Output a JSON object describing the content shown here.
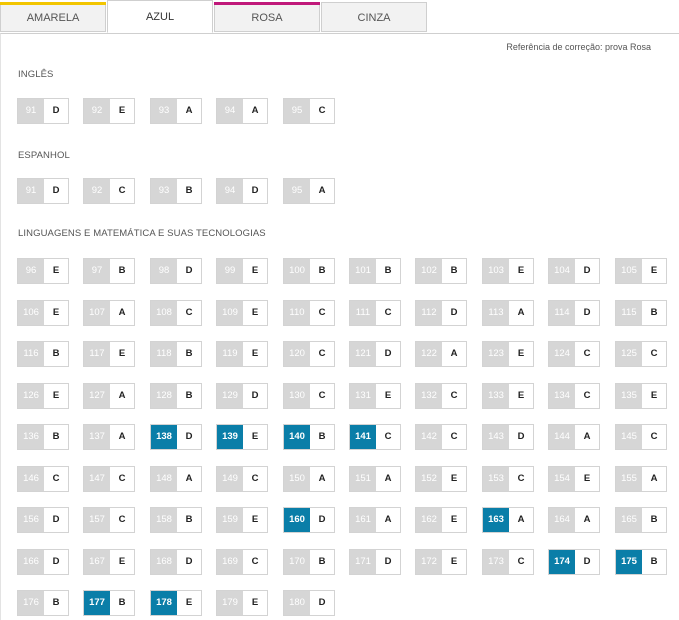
{
  "tabs": [
    {
      "label": "AMARELA",
      "color": "#f2c500",
      "active": false
    },
    {
      "label": "AZUL",
      "color": "#1a6fb5",
      "active": true
    },
    {
      "label": "ROSA",
      "color": "#c0197a",
      "active": false
    },
    {
      "label": "CINZA",
      "color": "#9b9b9b",
      "active": false
    }
  ],
  "reference_text": "Referência de correção: prova Rosa",
  "highlight_color": "#0a7ea8",
  "sections": [
    {
      "title": "INGLÊS",
      "items": [
        {
          "num": "91",
          "ans": "D"
        },
        {
          "num": "92",
          "ans": "E"
        },
        {
          "num": "93",
          "ans": "A"
        },
        {
          "num": "94",
          "ans": "A"
        },
        {
          "num": "95",
          "ans": "C"
        }
      ]
    },
    {
      "title": "ESPANHOL",
      "items": [
        {
          "num": "91",
          "ans": "D"
        },
        {
          "num": "92",
          "ans": "C"
        },
        {
          "num": "93",
          "ans": "B"
        },
        {
          "num": "94",
          "ans": "D"
        },
        {
          "num": "95",
          "ans": "A"
        }
      ]
    },
    {
      "title": "LINGUAGENS E MATEMÁTICA E SUAS TECNOLOGIAS",
      "items": [
        {
          "num": "96",
          "ans": "E"
        },
        {
          "num": "97",
          "ans": "B"
        },
        {
          "num": "98",
          "ans": "D"
        },
        {
          "num": "99",
          "ans": "E"
        },
        {
          "num": "100",
          "ans": "B"
        },
        {
          "num": "101",
          "ans": "B"
        },
        {
          "num": "102",
          "ans": "B"
        },
        {
          "num": "103",
          "ans": "E"
        },
        {
          "num": "104",
          "ans": "D"
        },
        {
          "num": "105",
          "ans": "E"
        },
        {
          "num": "106",
          "ans": "E"
        },
        {
          "num": "107",
          "ans": "A"
        },
        {
          "num": "108",
          "ans": "C"
        },
        {
          "num": "109",
          "ans": "E"
        },
        {
          "num": "110",
          "ans": "C"
        },
        {
          "num": "111",
          "ans": "C"
        },
        {
          "num": "112",
          "ans": "D"
        },
        {
          "num": "113",
          "ans": "A"
        },
        {
          "num": "114",
          "ans": "D"
        },
        {
          "num": "115",
          "ans": "B"
        },
        {
          "num": "116",
          "ans": "B"
        },
        {
          "num": "117",
          "ans": "E"
        },
        {
          "num": "118",
          "ans": "B"
        },
        {
          "num": "119",
          "ans": "E"
        },
        {
          "num": "120",
          "ans": "C"
        },
        {
          "num": "121",
          "ans": "D"
        },
        {
          "num": "122",
          "ans": "A"
        },
        {
          "num": "123",
          "ans": "E"
        },
        {
          "num": "124",
          "ans": "C"
        },
        {
          "num": "125",
          "ans": "C"
        },
        {
          "num": "126",
          "ans": "E"
        },
        {
          "num": "127",
          "ans": "A"
        },
        {
          "num": "128",
          "ans": "B"
        },
        {
          "num": "129",
          "ans": "D"
        },
        {
          "num": "130",
          "ans": "C"
        },
        {
          "num": "131",
          "ans": "E"
        },
        {
          "num": "132",
          "ans": "C"
        },
        {
          "num": "133",
          "ans": "E"
        },
        {
          "num": "134",
          "ans": "C"
        },
        {
          "num": "135",
          "ans": "E"
        },
        {
          "num": "136",
          "ans": "B"
        },
        {
          "num": "137",
          "ans": "A"
        },
        {
          "num": "138",
          "ans": "D",
          "hl": true
        },
        {
          "num": "139",
          "ans": "E",
          "hl": true
        },
        {
          "num": "140",
          "ans": "B",
          "hl": true
        },
        {
          "num": "141",
          "ans": "C",
          "hl": true
        },
        {
          "num": "142",
          "ans": "C"
        },
        {
          "num": "143",
          "ans": "D"
        },
        {
          "num": "144",
          "ans": "A"
        },
        {
          "num": "145",
          "ans": "C"
        },
        {
          "num": "146",
          "ans": "C"
        },
        {
          "num": "147",
          "ans": "C"
        },
        {
          "num": "148",
          "ans": "A"
        },
        {
          "num": "149",
          "ans": "C"
        },
        {
          "num": "150",
          "ans": "A"
        },
        {
          "num": "151",
          "ans": "A"
        },
        {
          "num": "152",
          "ans": "E"
        },
        {
          "num": "153",
          "ans": "C"
        },
        {
          "num": "154",
          "ans": "E"
        },
        {
          "num": "155",
          "ans": "A"
        },
        {
          "num": "156",
          "ans": "D"
        },
        {
          "num": "157",
          "ans": "C"
        },
        {
          "num": "158",
          "ans": "B"
        },
        {
          "num": "159",
          "ans": "E"
        },
        {
          "num": "160",
          "ans": "D",
          "hl": true
        },
        {
          "num": "161",
          "ans": "A"
        },
        {
          "num": "162",
          "ans": "E"
        },
        {
          "num": "163",
          "ans": "A",
          "hl": true
        },
        {
          "num": "164",
          "ans": "A"
        },
        {
          "num": "165",
          "ans": "B"
        },
        {
          "num": "166",
          "ans": "D"
        },
        {
          "num": "167",
          "ans": "E"
        },
        {
          "num": "168",
          "ans": "D"
        },
        {
          "num": "169",
          "ans": "C"
        },
        {
          "num": "170",
          "ans": "B"
        },
        {
          "num": "171",
          "ans": "D"
        },
        {
          "num": "172",
          "ans": "E"
        },
        {
          "num": "173",
          "ans": "C"
        },
        {
          "num": "174",
          "ans": "D",
          "hl": true
        },
        {
          "num": "175",
          "ans": "B",
          "hl": true
        },
        {
          "num": "176",
          "ans": "B"
        },
        {
          "num": "177",
          "ans": "B",
          "hl": true
        },
        {
          "num": "178",
          "ans": "E",
          "hl": true
        },
        {
          "num": "179",
          "ans": "E"
        },
        {
          "num": "180",
          "ans": "D"
        }
      ]
    }
  ]
}
